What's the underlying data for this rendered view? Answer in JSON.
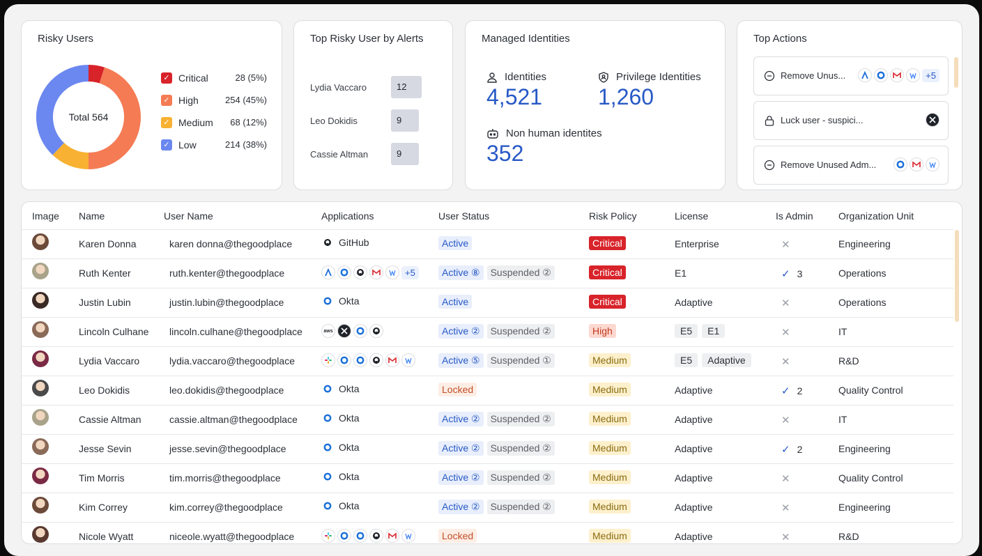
{
  "risky_users": {
    "title": "Risky Users",
    "total_label": "Total 564",
    "legend": [
      {
        "label": "Critical",
        "value": "28 (5%)",
        "color": "#d8232a",
        "count": 28
      },
      {
        "label": "High",
        "value": "254 (45%)",
        "color": "#f47b54",
        "count": 254
      },
      {
        "label": "Medium",
        "value": "68 (12%)",
        "color": "#f8b132",
        "count": 68
      },
      {
        "label": "Low",
        "value": "214 (38%)",
        "color": "#6b87f0",
        "count": 214
      }
    ]
  },
  "top_alerts": {
    "title": "Top Risky User by Alerts",
    "rows": [
      {
        "name": "Lydia Vaccaro",
        "count": "12",
        "value": 12
      },
      {
        "name": "Leo Dokidis",
        "count": "9",
        "value": 9
      },
      {
        "name": "Cassie Altman",
        "count": "9",
        "value": 9
      }
    ]
  },
  "managed": {
    "title": "Managed Identities",
    "identities_label": "Identities",
    "identities_value": "4,521",
    "privilege_label": "Privilege Identities",
    "privilege_value": "1,260",
    "nonhuman_label": "Non human identites",
    "nonhuman_value": "352"
  },
  "top_actions": {
    "title": "Top Actions",
    "items": [
      {
        "label": "Remove Unus...",
        "icon": "minus-circle-icon",
        "apps": [
          "atlassian",
          "okta",
          "gmail",
          "workspace"
        ],
        "more": "+5"
      },
      {
        "label": "Luck user - suspici...",
        "icon": "lock-icon",
        "apps": [
          "x"
        ],
        "more": ""
      },
      {
        "label": "Remove Unused Adm...",
        "icon": "minus-circle-icon",
        "apps": [
          "okta",
          "gmail",
          "workspace"
        ],
        "more": ""
      }
    ]
  },
  "table": {
    "headers": [
      "Image",
      "Name",
      "User Name",
      "Applications",
      "User Status",
      "Risk Policy",
      "License",
      "Is Admin",
      "Organization Unit"
    ],
    "rows": [
      {
        "name": "Karen Donna",
        "username": "karen donna@thegoodplace",
        "apps": {
          "type": "single",
          "icon": "github",
          "label": "GitHub"
        },
        "status": [
          {
            "kind": "active",
            "text": "Active"
          }
        ],
        "risk": {
          "kind": "critical",
          "text": "Critical"
        },
        "license": {
          "type": "text",
          "values": [
            "Enterprise"
          ]
        },
        "admin": {
          "is": false,
          "count": ""
        },
        "org": "Engineering",
        "avatar": "#6b4a3a"
      },
      {
        "name": "Ruth Kenter",
        "username": "ruth.kenter@thegoodplace",
        "apps": {
          "type": "multi",
          "icons": [
            "atlassian",
            "okta",
            "github",
            "gmail",
            "workspace"
          ],
          "more": "+5"
        },
        "status": [
          {
            "kind": "active",
            "text": "Active ⑧"
          },
          {
            "kind": "susp",
            "text": "Suspended ②"
          }
        ],
        "risk": {
          "kind": "critical",
          "text": "Critical"
        },
        "license": {
          "type": "text",
          "values": [
            "E1"
          ]
        },
        "admin": {
          "is": true,
          "count": "3"
        },
        "org": "Operations",
        "avatar": "#a8a38a"
      },
      {
        "name": "Justin Lubin",
        "username": "justin.lubin@thegoodplace",
        "apps": {
          "type": "single",
          "icon": "okta",
          "label": "Okta"
        },
        "status": [
          {
            "kind": "active",
            "text": "Active"
          }
        ],
        "risk": {
          "kind": "critical",
          "text": "Critical"
        },
        "license": {
          "type": "text",
          "values": [
            "Adaptive"
          ]
        },
        "admin": {
          "is": false,
          "count": ""
        },
        "org": "Operations",
        "avatar": "#3a2a26"
      },
      {
        "name": "Lincoln Culhane",
        "username": "lincoln.culhane@thegoodplace",
        "apps": {
          "type": "multi",
          "icons": [
            "aws",
            "x",
            "okta",
            "github"
          ],
          "more": ""
        },
        "status": [
          {
            "kind": "active",
            "text": "Active ②"
          },
          {
            "kind": "susp",
            "text": "Suspended ②"
          }
        ],
        "risk": {
          "kind": "high",
          "text": "High"
        },
        "license": {
          "type": "chips",
          "values": [
            "E5",
            "E1"
          ]
        },
        "admin": {
          "is": false,
          "count": ""
        },
        "org": "IT",
        "avatar": "#8a6a58"
      },
      {
        "name": "Lydia Vaccaro",
        "username": "lydia.vaccaro@thegoodplace",
        "apps": {
          "type": "multi",
          "icons": [
            "slack",
            "okta",
            "okta",
            "github",
            "gmail",
            "workspace"
          ],
          "more": ""
        },
        "status": [
          {
            "kind": "active",
            "text": "Active ⑤"
          },
          {
            "kind": "susp",
            "text": "Suspended ①"
          }
        ],
        "risk": {
          "kind": "medium",
          "text": "Medium"
        },
        "license": {
          "type": "chips",
          "values": [
            "E5",
            "Adaptive"
          ]
        },
        "admin": {
          "is": false,
          "count": ""
        },
        "org": "R&D",
        "avatar": "#7a2a44"
      },
      {
        "name": "Leo Dokidis",
        "username": "leo.dokidis@thegoodplace",
        "apps": {
          "type": "single",
          "icon": "okta",
          "label": "Okta"
        },
        "status": [
          {
            "kind": "locked",
            "text": "Locked"
          }
        ],
        "risk": {
          "kind": "medium",
          "text": "Medium"
        },
        "license": {
          "type": "text",
          "values": [
            "Adaptive"
          ]
        },
        "admin": {
          "is": true,
          "count": "2"
        },
        "org": "Quality Control",
        "avatar": "#4a4a4a"
      },
      {
        "name": "Cassie Altman",
        "username": "cassie.altman@thegoodplace",
        "apps": {
          "type": "single",
          "icon": "okta",
          "label": "Okta"
        },
        "status": [
          {
            "kind": "active",
            "text": "Active ②"
          },
          {
            "kind": "susp",
            "text": "Suspended ②"
          }
        ],
        "risk": {
          "kind": "medium",
          "text": "Medium"
        },
        "license": {
          "type": "text",
          "values": [
            "Adaptive"
          ]
        },
        "admin": {
          "is": false,
          "count": ""
        },
        "org": "IT",
        "avatar": "#a8a38a"
      },
      {
        "name": "Jesse Sevin",
        "username": "jesse.sevin@thegoodplace",
        "apps": {
          "type": "single",
          "icon": "okta",
          "label": "Okta"
        },
        "status": [
          {
            "kind": "active",
            "text": "Active ②"
          },
          {
            "kind": "susp",
            "text": "Suspended ②"
          }
        ],
        "risk": {
          "kind": "medium",
          "text": "Medium"
        },
        "license": {
          "type": "text",
          "values": [
            "Adaptive"
          ]
        },
        "admin": {
          "is": true,
          "count": "2"
        },
        "org": "Engineering",
        "avatar": "#8a6a58"
      },
      {
        "name": "Tim Morris",
        "username": "tim.morris@thegoodplace",
        "apps": {
          "type": "single",
          "icon": "okta",
          "label": "Okta"
        },
        "status": [
          {
            "kind": "active",
            "text": "Active ②"
          },
          {
            "kind": "susp",
            "text": "Suspended ②"
          }
        ],
        "risk": {
          "kind": "medium",
          "text": "Medium"
        },
        "license": {
          "type": "text",
          "values": [
            "Adaptive"
          ]
        },
        "admin": {
          "is": false,
          "count": ""
        },
        "org": "Quality Control",
        "avatar": "#7a2a44"
      },
      {
        "name": "Kim Correy",
        "username": "kim.correy@thegoodplace",
        "apps": {
          "type": "single",
          "icon": "okta",
          "label": "Okta"
        },
        "status": [
          {
            "kind": "active",
            "text": "Active ②"
          },
          {
            "kind": "susp",
            "text": "Suspended ②"
          }
        ],
        "risk": {
          "kind": "medium",
          "text": "Medium"
        },
        "license": {
          "type": "text",
          "values": [
            "Adaptive"
          ]
        },
        "admin": {
          "is": false,
          "count": ""
        },
        "org": "Engineering",
        "avatar": "#6b4a3a"
      },
      {
        "name": "Nicole Wyatt",
        "username": "niceole.wyatt@thegoodplace",
        "apps": {
          "type": "multi",
          "icons": [
            "slack",
            "okta",
            "okta",
            "github",
            "gmail",
            "workspace"
          ],
          "more": ""
        },
        "status": [
          {
            "kind": "locked",
            "text": "Locked"
          }
        ],
        "risk": {
          "kind": "medium",
          "text": "Medium"
        },
        "license": {
          "type": "text",
          "values": [
            "Adaptive"
          ]
        },
        "admin": {
          "is": false,
          "count": ""
        },
        "org": "R&D",
        "avatar": "#5a3a30"
      }
    ]
  }
}
